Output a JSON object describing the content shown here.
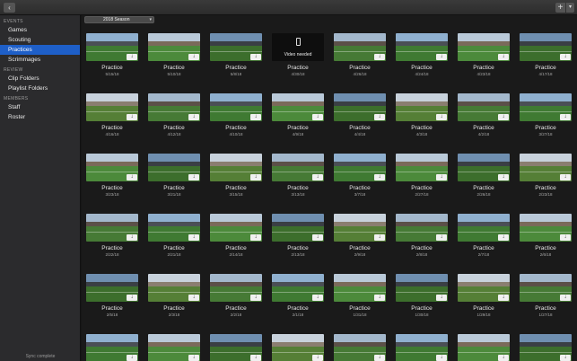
{
  "titlebar": {
    "back_icon": "chevron-left-icon",
    "add_icon": "plus-icon",
    "menu_icon": "chevron-down-icon"
  },
  "sidebar": {
    "sections": [
      {
        "header": "EVENTS",
        "items": [
          {
            "label": "Games",
            "selected": false
          },
          {
            "label": "Scouting",
            "selected": false
          },
          {
            "label": "Practices",
            "selected": true
          },
          {
            "label": "Scrimmages",
            "selected": false
          }
        ]
      },
      {
        "header": "REVIEW",
        "items": [
          {
            "label": "Clip Folders",
            "selected": false
          },
          {
            "label": "Playlist Folders",
            "selected": false
          }
        ]
      },
      {
        "header": "MEMBERS",
        "items": [
          {
            "label": "Staff",
            "selected": false
          },
          {
            "label": "Roster",
            "selected": false
          }
        ]
      }
    ],
    "sync_status": "Sync complete"
  },
  "toolbar": {
    "season": "2018 Season"
  },
  "colors": {
    "accent": "#1e5fc8",
    "sidebar_bg": "#2b2b2d",
    "main_bg": "#1a1a1a"
  },
  "events": [
    {
      "title": "Practice",
      "date": "5/15/18",
      "video_needed": false
    },
    {
      "title": "Practice",
      "date": "5/10/18",
      "video_needed": false
    },
    {
      "title": "Practice",
      "date": "5/8/18",
      "video_needed": false
    },
    {
      "title": "Practice",
      "date": "4/30/18",
      "video_needed": true,
      "video_needed_label": "Video needed"
    },
    {
      "title": "Practice",
      "date": "4/26/18",
      "video_needed": false
    },
    {
      "title": "Practice",
      "date": "4/24/18",
      "video_needed": false
    },
    {
      "title": "Practice",
      "date": "4/23/18",
      "video_needed": false
    },
    {
      "title": "Practice",
      "date": "4/17/18",
      "video_needed": false
    },
    {
      "title": "Practice",
      "date": "4/16/18",
      "video_needed": false
    },
    {
      "title": "Practice",
      "date": "4/12/18",
      "video_needed": false
    },
    {
      "title": "Practice",
      "date": "4/10/18",
      "video_needed": false
    },
    {
      "title": "Practice",
      "date": "4/9/18",
      "video_needed": false
    },
    {
      "title": "Practice",
      "date": "4/4/18",
      "video_needed": false
    },
    {
      "title": "Practice",
      "date": "4/3/18",
      "video_needed": false
    },
    {
      "title": "Practice",
      "date": "4/2/18",
      "video_needed": false
    },
    {
      "title": "Practice",
      "date": "3/27/18",
      "video_needed": false
    },
    {
      "title": "Practice",
      "date": "3/23/18",
      "video_needed": false
    },
    {
      "title": "Practice",
      "date": "3/21/18",
      "video_needed": false
    },
    {
      "title": "Practice",
      "date": "3/15/18",
      "video_needed": false
    },
    {
      "title": "Practice",
      "date": "3/13/18",
      "video_needed": false
    },
    {
      "title": "Practice",
      "date": "3/7/18",
      "video_needed": false
    },
    {
      "title": "Practice",
      "date": "2/27/18",
      "video_needed": false
    },
    {
      "title": "Practice",
      "date": "2/26/18",
      "video_needed": false
    },
    {
      "title": "Practice",
      "date": "2/23/18",
      "video_needed": false
    },
    {
      "title": "Practice",
      "date": "2/22/18",
      "video_needed": false
    },
    {
      "title": "Practice",
      "date": "2/21/18",
      "video_needed": false
    },
    {
      "title": "Practice",
      "date": "2/14/18",
      "video_needed": false
    },
    {
      "title": "Practice",
      "date": "2/13/18",
      "video_needed": false
    },
    {
      "title": "Practice",
      "date": "2/9/18",
      "video_needed": false
    },
    {
      "title": "Practice",
      "date": "2/8/18",
      "video_needed": false
    },
    {
      "title": "Practice",
      "date": "2/7/18",
      "video_needed": false
    },
    {
      "title": "Practice",
      "date": "2/6/18",
      "video_needed": false
    },
    {
      "title": "Practice",
      "date": "2/5/18",
      "video_needed": false
    },
    {
      "title": "Practice",
      "date": "2/3/18",
      "video_needed": false
    },
    {
      "title": "Practice",
      "date": "2/2/18",
      "video_needed": false
    },
    {
      "title": "Practice",
      "date": "2/1/18",
      "video_needed": false
    },
    {
      "title": "Practice",
      "date": "1/31/18",
      "video_needed": false
    },
    {
      "title": "Practice",
      "date": "1/30/18",
      "video_needed": false
    },
    {
      "title": "Practice",
      "date": "1/29/18",
      "video_needed": false
    },
    {
      "title": "Practice",
      "date": "1/27/18",
      "video_needed": false
    },
    {
      "title": "",
      "date": "",
      "video_needed": false
    },
    {
      "title": "",
      "date": "",
      "video_needed": false
    },
    {
      "title": "",
      "date": "",
      "video_needed": false
    },
    {
      "title": "",
      "date": "",
      "video_needed": false
    },
    {
      "title": "",
      "date": "",
      "video_needed": false
    },
    {
      "title": "",
      "date": "",
      "video_needed": false
    },
    {
      "title": "",
      "date": "",
      "video_needed": false
    },
    {
      "title": "",
      "date": "",
      "video_needed": false
    }
  ]
}
